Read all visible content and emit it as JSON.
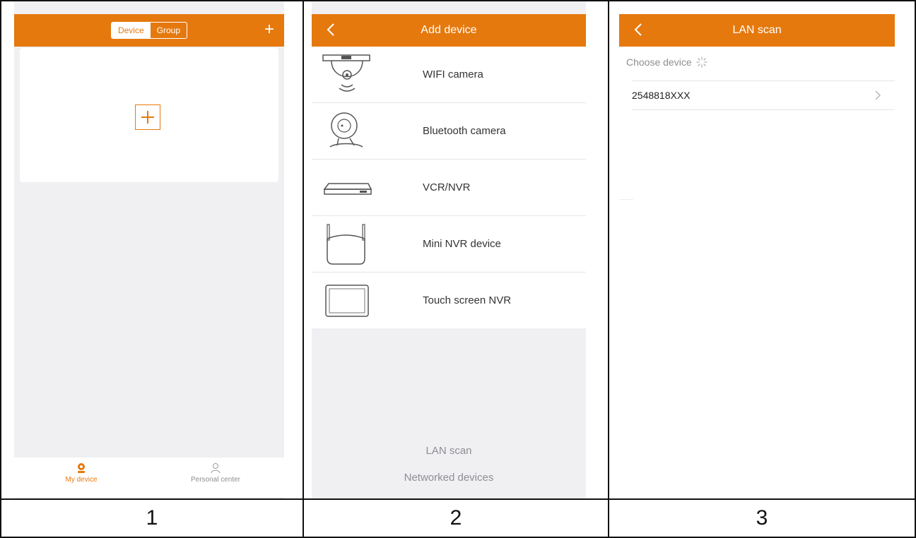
{
  "panel1": {
    "segment": {
      "device": "Device",
      "group": "Group",
      "active": "Device"
    },
    "plus_icon": "plus-icon",
    "tabs": [
      {
        "label": "My device",
        "icon": "camera-icon",
        "active": true
      },
      {
        "label": "Personal center",
        "icon": "person-icon",
        "active": false
      }
    ],
    "caption": "1"
  },
  "panel2": {
    "title": "Add device",
    "items": [
      {
        "label": "WIFI camera",
        "icon": "wifi-camera-icon"
      },
      {
        "label": "Bluetooth camera",
        "icon": "bluetooth-camera-icon"
      },
      {
        "label": "VCR/NVR",
        "icon": "nvr-recorder-icon"
      },
      {
        "label": "Mini NVR device",
        "icon": "mini-nvr-icon"
      },
      {
        "label": "Touch screen NVR",
        "icon": "touch-screen-icon"
      }
    ],
    "links": {
      "lan_scan": "LAN scan",
      "networked": "Networked devices"
    },
    "caption": "2"
  },
  "panel3": {
    "title": "LAN scan",
    "section_label": "Choose device",
    "devices": [
      {
        "id": "2548818XXX"
      }
    ],
    "caption": "3"
  },
  "colors": {
    "accent": "#e5790e",
    "background": "#f0f0f3",
    "separator": "#e6e6e6"
  }
}
